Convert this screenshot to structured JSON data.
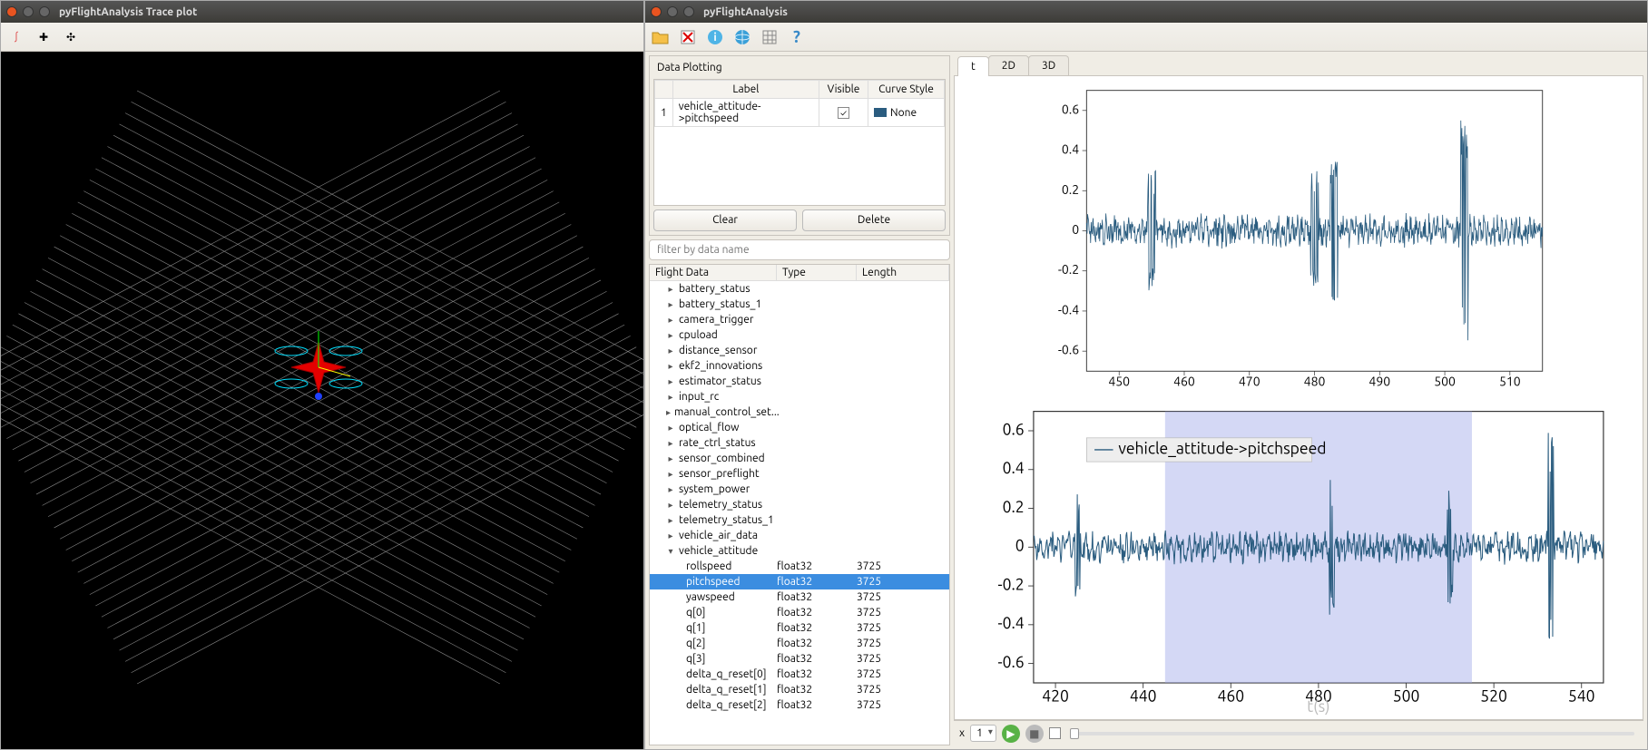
{
  "left": {
    "title": "pyFlightAnalysis  Trace plot"
  },
  "right": {
    "title": "pyFlightAnalysis",
    "toolbar": {
      "open": "open-folder",
      "delete": "delete",
      "info": "info",
      "globe": "globe",
      "grid": "grid-settings",
      "help": "?"
    },
    "dataPlotting": {
      "title": "Data Plotting",
      "headers": {
        "idx": "",
        "label": "Label",
        "visible": "Visible",
        "curve": "Curve Style"
      },
      "rows": [
        {
          "idx": "1",
          "label": "vehicle_attitude->pitchspeed",
          "visible": true,
          "curve": "None"
        }
      ],
      "clear": "Clear",
      "delete": "Delete"
    },
    "filter": {
      "placeholder": "filter by data name"
    },
    "flightData": {
      "headers": {
        "name": "Flight Data",
        "type": "Type",
        "length": "Length"
      },
      "topics": [
        "battery_status",
        "battery_status_1",
        "camera_trigger",
        "cpuload",
        "distance_sensor",
        "ekf2_innovations",
        "estimator_status",
        "input_rc",
        "manual_control_set...",
        "optical_flow",
        "rate_ctrl_status",
        "sensor_combined",
        "sensor_preflight",
        "system_power",
        "telemetry_status",
        "telemetry_status_1",
        "vehicle_air_data"
      ],
      "expanded": {
        "name": "vehicle_attitude",
        "children": [
          {
            "name": "rollspeed",
            "type": "float32",
            "len": "3725",
            "sel": false
          },
          {
            "name": "pitchspeed",
            "type": "float32",
            "len": "3725",
            "sel": true
          },
          {
            "name": "yawspeed",
            "type": "float32",
            "len": "3725",
            "sel": false
          },
          {
            "name": "q[0]",
            "type": "float32",
            "len": "3725",
            "sel": false
          },
          {
            "name": "q[1]",
            "type": "float32",
            "len": "3725",
            "sel": false
          },
          {
            "name": "q[2]",
            "type": "float32",
            "len": "3725",
            "sel": false
          },
          {
            "name": "q[3]",
            "type": "float32",
            "len": "3725",
            "sel": false
          },
          {
            "name": "delta_q_reset[0]",
            "type": "float32",
            "len": "3725",
            "sel": false
          },
          {
            "name": "delta_q_reset[1]",
            "type": "float32",
            "len": "3725",
            "sel": false
          },
          {
            "name": "delta_q_reset[2]",
            "type": "float32",
            "len": "3725",
            "sel": false
          }
        ]
      }
    },
    "tabs": {
      "t": "t",
      "d2": "2D",
      "d3": "3D"
    },
    "playback": {
      "x": "x",
      "speed": "1"
    }
  },
  "chart_data": [
    {
      "type": "line",
      "title": "",
      "xlabel": "",
      "ylabel": "",
      "xlim": [
        445,
        515
      ],
      "ylim": [
        -0.7,
        0.7
      ],
      "xticks": [
        450,
        460,
        470,
        480,
        490,
        500,
        510
      ],
      "yticks": [
        -0.6,
        -0.4,
        -0.2,
        0,
        0.2,
        0.4,
        0.6
      ],
      "series": [
        {
          "name": "vehicle_attitude->pitchspeed",
          "color": "#2a5c7f",
          "note": "high-frequency noisy signal oscillating around 0, amplitude mostly ±0.1 with spikes to ~±0.35 near x≈473 and a spike to +0.65 / -0.55 near x≈498"
        }
      ]
    },
    {
      "type": "line",
      "title": "",
      "xlabel": "t(s)",
      "ylabel": "",
      "xlim": [
        415,
        545
      ],
      "ylim": [
        -0.7,
        0.7
      ],
      "xticks": [
        420,
        440,
        460,
        480,
        500,
        520,
        540
      ],
      "yticks": [
        -0.6,
        -0.4,
        -0.2,
        0,
        0.2,
        0.4,
        0.6
      ],
      "selection": [
        445,
        515
      ],
      "legend": "vehicle_attitude->pitchspeed",
      "series": [
        {
          "name": "vehicle_attitude->pitchspeed",
          "color": "#2a5c7f",
          "note": "same signal over wider window 415–545s; amplitude mostly ±0.1, spikes ±0.35 near 430,445,473,508,535 and big spike +0.65/-0.55 near 498; highlighted region 445–515"
        }
      ]
    }
  ]
}
